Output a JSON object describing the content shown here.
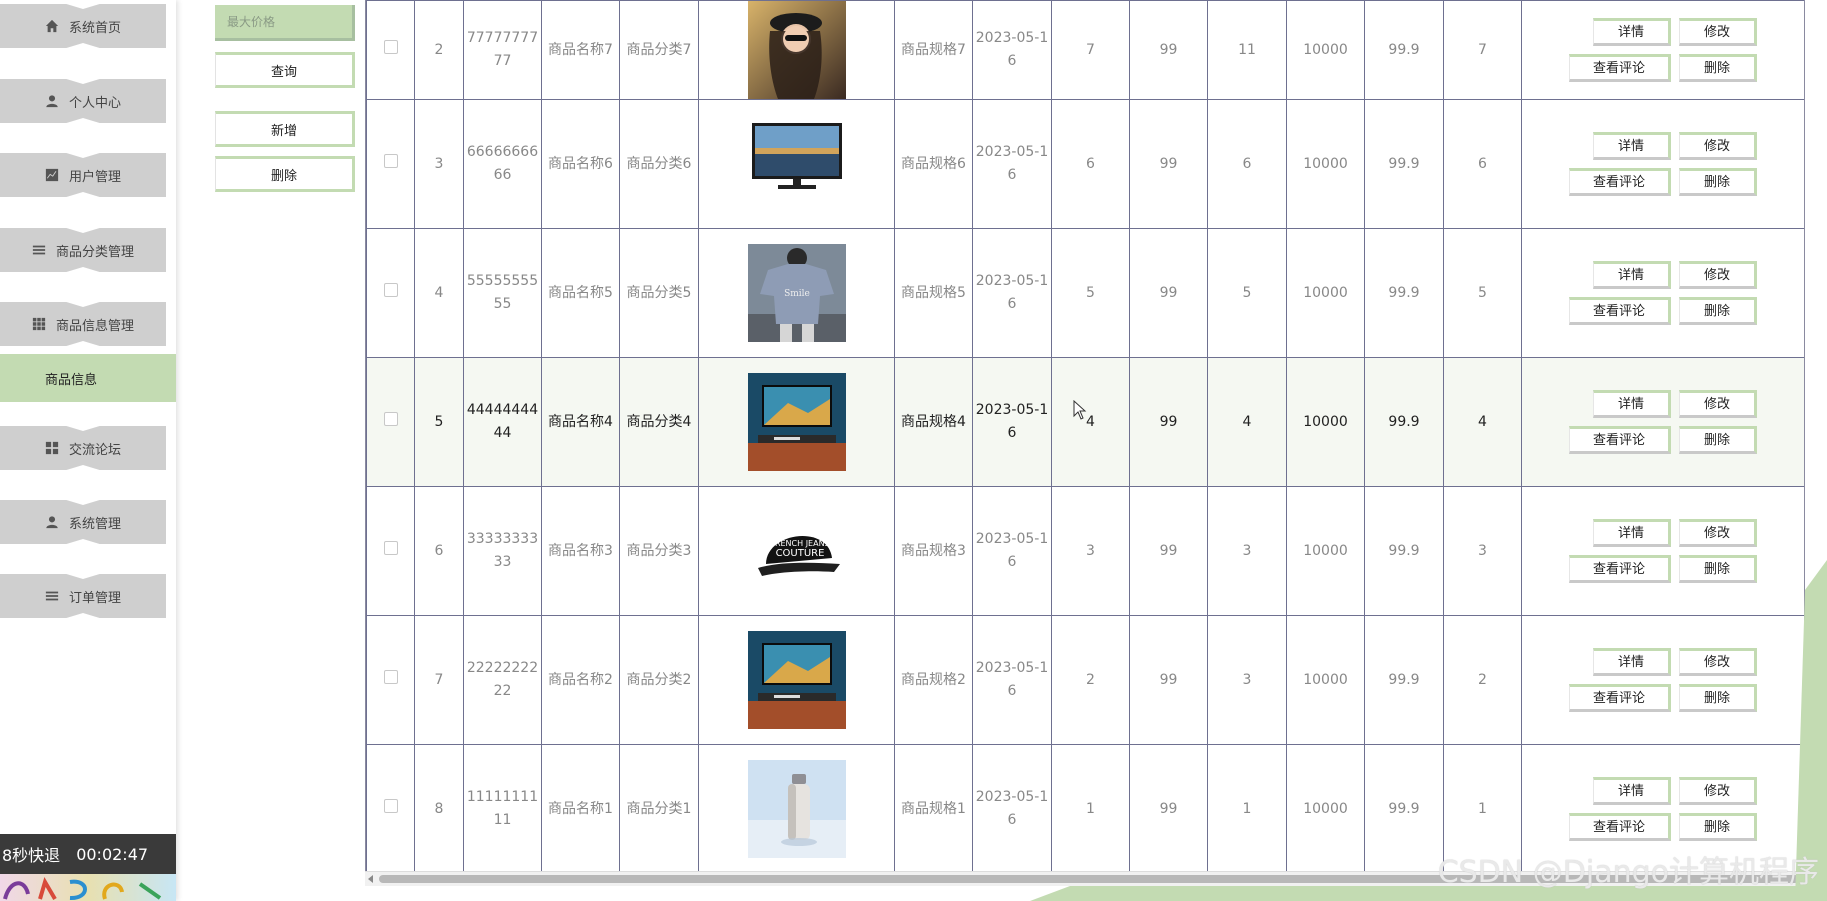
{
  "sidebar": {
    "items": [
      {
        "label": "系统首页",
        "icon": "home-icon"
      },
      {
        "label": "个人中心",
        "icon": "user-icon"
      },
      {
        "label": "用户管理",
        "icon": "chart-icon"
      },
      {
        "label": "商品分类管理",
        "icon": "list-icon"
      },
      {
        "label": "商品信息管理",
        "icon": "grid-icon"
      },
      {
        "label": "交流论坛",
        "icon": "blocks-icon"
      },
      {
        "label": "系统管理",
        "icon": "user-icon"
      },
      {
        "label": "订单管理",
        "icon": "list-icon"
      }
    ],
    "active_sub": "商品信息"
  },
  "search_panel": {
    "max_price_placeholder": "最大价格",
    "query_label": "查询",
    "add_label": "新增",
    "delete_label": "删除"
  },
  "rows": [
    {
      "index": "2",
      "code": "7777777777",
      "name": "商品名称7",
      "category": "商品分类7",
      "image": "photo-woman-hat",
      "spec": "商品规格7",
      "date": "2023-05-16",
      "c1": "7",
      "c2": "99",
      "c3": "11",
      "c4": "10000",
      "price": "99.9",
      "c5": "7"
    },
    {
      "index": "3",
      "code": "6666666666",
      "name": "商品名称6",
      "category": "商品分类6",
      "image": "photo-monitor",
      "spec": "商品规格6",
      "date": "2023-05-16",
      "c1": "6",
      "c2": "99",
      "c3": "6",
      "c4": "10000",
      "price": "99.9",
      "c5": "6"
    },
    {
      "index": "4",
      "code": "5555555555",
      "name": "商品名称5",
      "category": "商品分类5",
      "image": "photo-tshirt",
      "spec": "商品规格5",
      "date": "2023-05-16",
      "c1": "5",
      "c2": "99",
      "c3": "5",
      "c4": "10000",
      "price": "99.9",
      "c5": "5"
    },
    {
      "index": "5",
      "code": "4444444444",
      "name": "商品名称4",
      "category": "商品分类4",
      "image": "photo-desk-tv",
      "spec": "商品规格4",
      "date": "2023-05-16",
      "c1": "4",
      "c2": "99",
      "c3": "4",
      "c4": "10000",
      "price": "99.9",
      "c5": "4"
    },
    {
      "index": "6",
      "code": "3333333333",
      "name": "商品名称3",
      "category": "商品分类3",
      "image": "photo-cap",
      "spec": "商品规格3",
      "date": "2023-05-16",
      "c1": "3",
      "c2": "99",
      "c3": "3",
      "c4": "10000",
      "price": "99.9",
      "c5": "3"
    },
    {
      "index": "7",
      "code": "2222222222",
      "name": "商品名称2",
      "category": "商品分类2",
      "image": "photo-desk-tv",
      "spec": "商品规格2",
      "date": "2023-05-16",
      "c1": "2",
      "c2": "99",
      "c3": "3",
      "c4": "10000",
      "price": "99.9",
      "c5": "2"
    },
    {
      "index": "8",
      "code": "1111111111",
      "name": "商品名称1",
      "category": "商品分类1",
      "image": "photo-bottle",
      "spec": "商品规格1",
      "date": "2023-05-16",
      "c1": "1",
      "c2": "99",
      "c3": "1",
      "c4": "10000",
      "price": "99.9",
      "c5": "1"
    }
  ],
  "row_actions": {
    "detail": "详情",
    "edit": "修改",
    "comments": "查看评论",
    "delete": "删除"
  },
  "video": {
    "rewind": "8秒快退",
    "time": "00:02:47"
  },
  "watermark": "CSDN @Django计算机程序",
  "colors": {
    "accent": "#c3dbb2",
    "menu_bg": "#cfcfcf",
    "grid_line": "#6e7090"
  }
}
